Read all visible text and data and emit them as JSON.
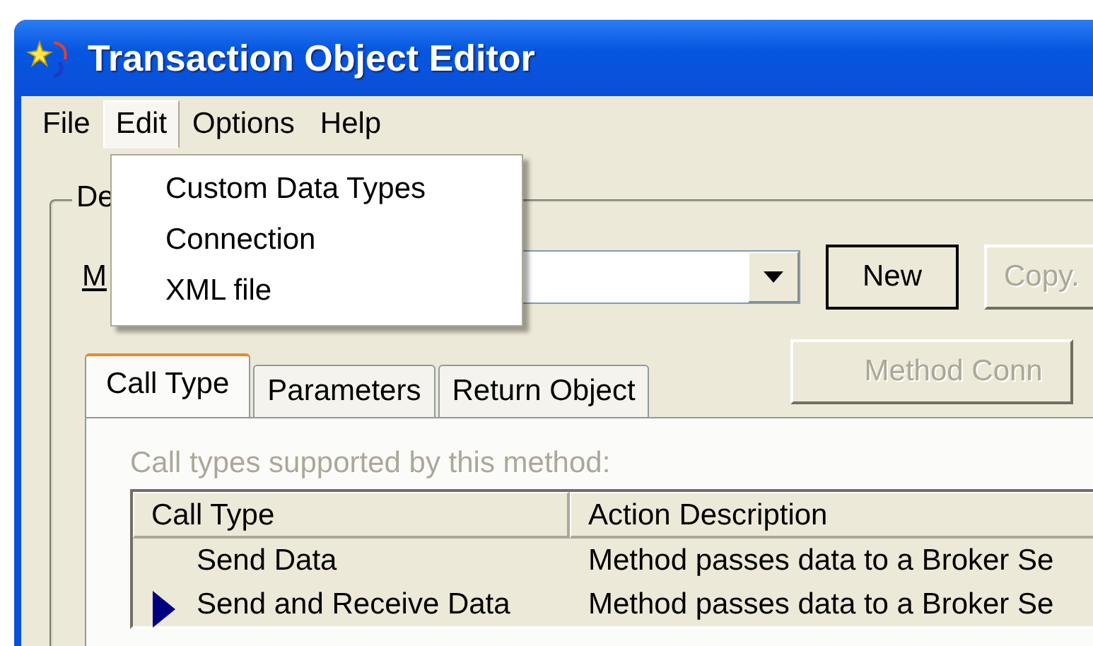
{
  "window": {
    "title": "Transaction Object Editor"
  },
  "menu_bar": [
    {
      "label": "File",
      "selected": false
    },
    {
      "label": "Edit",
      "selected": true
    },
    {
      "label": "Options",
      "selected": false
    },
    {
      "label": "Help",
      "selected": false
    }
  ],
  "open_menu": {
    "items": [
      "Custom Data Types",
      "Connection",
      "XML file"
    ]
  },
  "group": {
    "legend": "De",
    "method_label": "M",
    "buttons": [
      {
        "label": "New",
        "disabled": false,
        "default": true
      },
      {
        "label": "Copy.",
        "disabled": true,
        "default": false
      }
    ],
    "method_button": {
      "label": "Method Conn",
      "disabled": true
    },
    "tabs": [
      {
        "label": "Call Type",
        "selected": true
      },
      {
        "label": "Parameters",
        "selected": false
      },
      {
        "label": "Return Object",
        "selected": false
      }
    ],
    "panel": {
      "caption": "Call types supported by this method:",
      "caption_disabled": true,
      "table": {
        "columns": [
          "Call Type",
          "Action Description"
        ],
        "rows": [
          {
            "cells": [
              "Send Data",
              "Method passes data to a Broker Se"
            ],
            "current": false
          },
          {
            "cells": [
              "Send and Receive Data",
              "Method passes data to a Broker Se"
            ],
            "current": true
          }
        ]
      }
    }
  }
}
